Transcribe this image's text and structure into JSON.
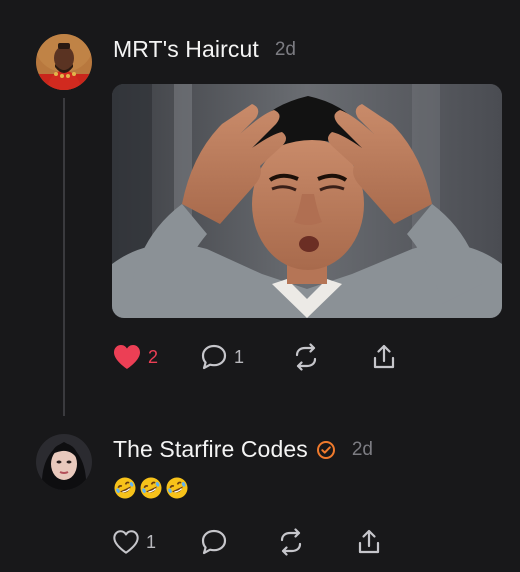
{
  "posts": [
    {
      "username": "MRT's Haircut",
      "time": "2d",
      "liked": true,
      "like_count": "2",
      "comment_count": "1",
      "media": "gif-image"
    },
    {
      "username": "The Starfire Codes",
      "verified": true,
      "time": "2d",
      "text": "🤣🤣🤣",
      "liked": false,
      "like_count": "1",
      "comment_count": ""
    }
  ],
  "colors": {
    "background": "#18181a",
    "like_active": "#ec3f55",
    "verified_badge": "#f07a2c",
    "muted_text": "#7c7c82",
    "icon": "#c6c6cb"
  },
  "icons": {
    "like": "heart-icon",
    "comment": "speech-bubble-icon",
    "repost": "repost-arrows-icon",
    "share": "share-upload-icon",
    "verified": "verified-badge-icon"
  }
}
